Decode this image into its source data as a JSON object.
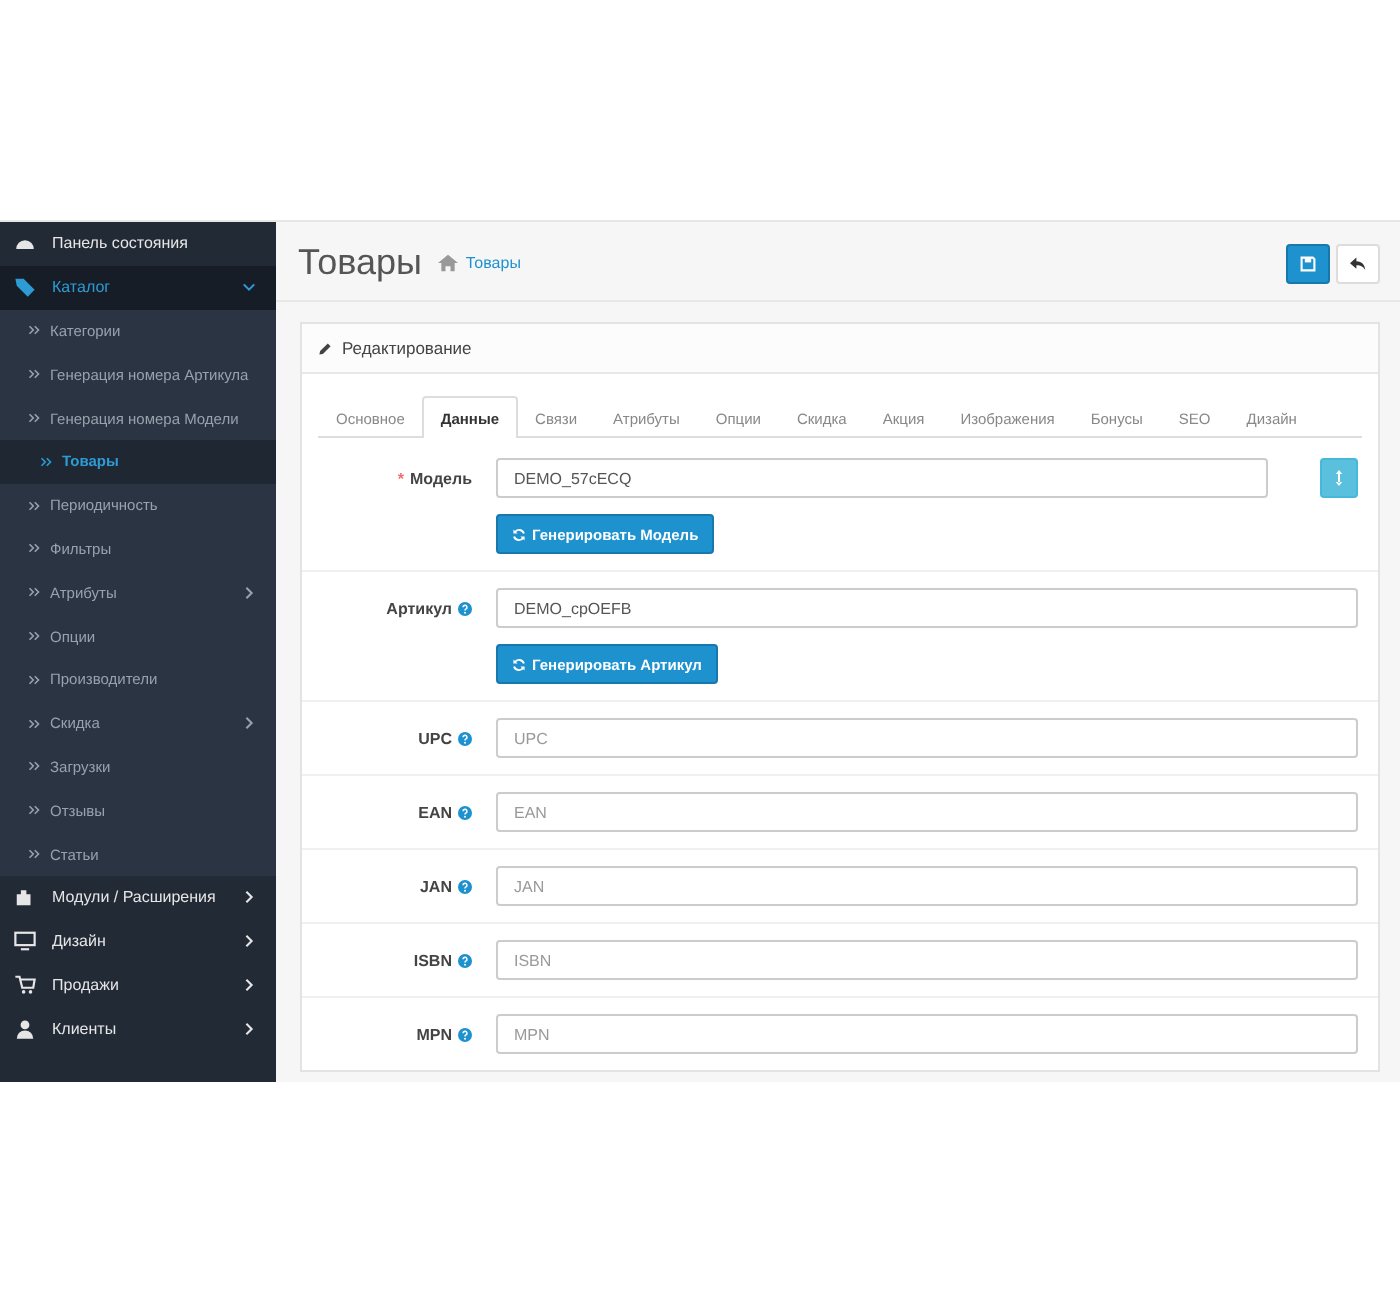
{
  "sidebar": {
    "items": [
      {
        "label": "Панель состояния",
        "selected": false,
        "has_submenu": false
      },
      {
        "label": "Каталог",
        "selected": true,
        "expanded": true,
        "has_submenu": true,
        "children": [
          {
            "label": "Категории",
            "selected": false,
            "has_submenu": false
          },
          {
            "label": "Генерация номера Артикула",
            "selected": false,
            "has_submenu": false
          },
          {
            "label": "Генерация номера Модели",
            "selected": false,
            "has_submenu": false
          },
          {
            "label": "Товары",
            "selected": true,
            "has_submenu": false
          },
          {
            "label": "Периодичность",
            "selected": false,
            "has_submenu": false
          },
          {
            "label": "Фильтры",
            "selected": false,
            "has_submenu": false
          },
          {
            "label": "Атрибуты",
            "selected": false,
            "has_submenu": true
          },
          {
            "label": "Опции",
            "selected": false,
            "has_submenu": false
          },
          {
            "label": "Производители",
            "selected": false,
            "has_submenu": false
          },
          {
            "label": "Скидка",
            "selected": false,
            "has_submenu": true
          },
          {
            "label": "Загрузки",
            "selected": false,
            "has_submenu": false
          },
          {
            "label": "Отзывы",
            "selected": false,
            "has_submenu": false
          },
          {
            "label": "Статьи",
            "selected": false,
            "has_submenu": false
          }
        ]
      },
      {
        "label": "Модули / Расширения",
        "selected": false,
        "has_submenu": true
      },
      {
        "label": "Дизайн",
        "selected": false,
        "has_submenu": true
      },
      {
        "label": "Продажи",
        "selected": false,
        "has_submenu": true
      },
      {
        "label": "Клиенты",
        "selected": false,
        "has_submenu": true
      }
    ]
  },
  "page": {
    "title": "Товары",
    "breadcrumb": "Товары"
  },
  "panel": {
    "title": "Редактирование",
    "tabs": [
      {
        "label": "Основное",
        "selected": false
      },
      {
        "label": "Данные",
        "selected": true
      },
      {
        "label": "Связи",
        "selected": false
      },
      {
        "label": "Атрибуты",
        "selected": false
      },
      {
        "label": "Опции",
        "selected": false
      },
      {
        "label": "Скидка",
        "selected": false
      },
      {
        "label": "Акция",
        "selected": false
      },
      {
        "label": "Изображения",
        "selected": false
      },
      {
        "label": "Бонусы",
        "selected": false
      },
      {
        "label": "SEO",
        "selected": false
      },
      {
        "label": "Дизайн",
        "selected": false
      }
    ],
    "rows": [
      {
        "label": "Модель",
        "required_mark": "*",
        "help": false,
        "value": "DEMO_57cECQ",
        "button": "Генерировать Модель",
        "side_button": true
      },
      {
        "label": "Артикул",
        "help": true,
        "value": "DEMO_cpOEFB",
        "button": "Генерировать Артикул",
        "side_button": false
      },
      {
        "label": "UPC",
        "help": true,
        "placeholder": "UPC",
        "side_button": false
      },
      {
        "label": "EAN",
        "help": true,
        "placeholder": "EAN",
        "side_button": false
      },
      {
        "label": "JAN",
        "help": true,
        "placeholder": "JAN",
        "side_button": false
      },
      {
        "label": "ISBN",
        "help": true,
        "placeholder": "ISBN",
        "side_button": false
      },
      {
        "label": "MPN",
        "help": true,
        "placeholder": "MPN",
        "side_button": false
      }
    ]
  }
}
